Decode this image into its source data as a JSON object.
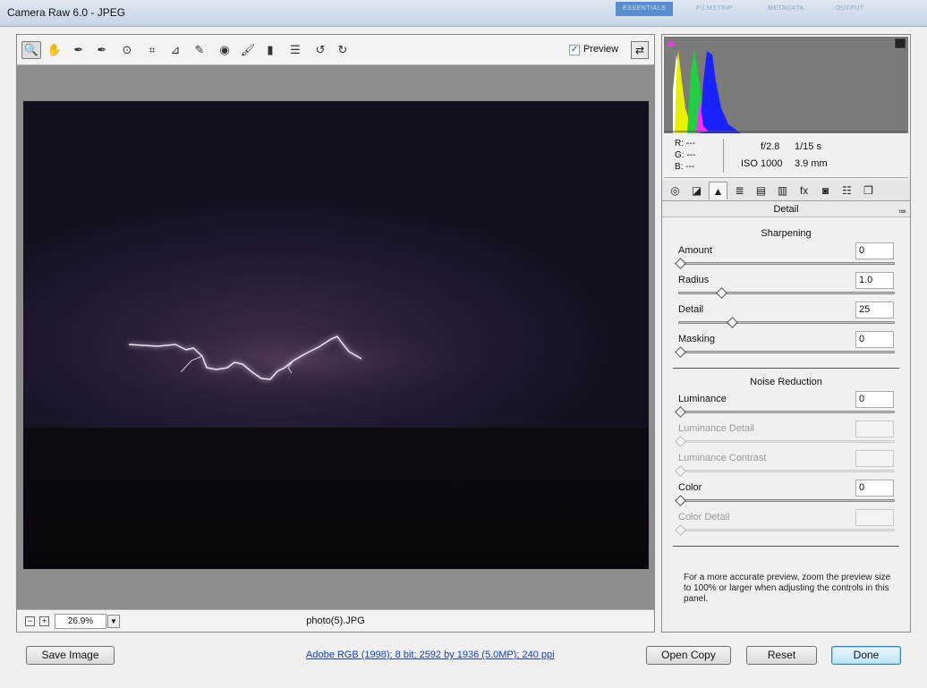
{
  "window": {
    "title": "Camera Raw 6.0  -  JPEG"
  },
  "workspace_tabs": [
    "ESSENTIALS",
    "FILMSTRIP",
    "METADATA",
    "OUTPUT"
  ],
  "toolbar": {
    "tools": [
      {
        "name": "zoom-tool",
        "glyph": "🔍"
      },
      {
        "name": "hand-tool",
        "glyph": "✋"
      },
      {
        "name": "white-balance-tool",
        "glyph": "✒"
      },
      {
        "name": "color-sampler-tool",
        "glyph": "✒"
      },
      {
        "name": "targeted-adjustment-tool",
        "glyph": "⊙"
      },
      {
        "name": "crop-tool",
        "glyph": "⌗"
      },
      {
        "name": "straighten-tool",
        "glyph": "⊿"
      },
      {
        "name": "spot-removal-tool",
        "glyph": "✎"
      },
      {
        "name": "red-eye-removal-tool",
        "glyph": "◉"
      },
      {
        "name": "adjustment-brush-tool",
        "glyph": "🖌"
      },
      {
        "name": "graduated-filter-tool",
        "glyph": "▮"
      },
      {
        "name": "preferences-tool",
        "glyph": "☰"
      },
      {
        "name": "rotate-ccw-tool",
        "glyph": "↺"
      },
      {
        "name": "rotate-cw-tool",
        "glyph": "↻"
      }
    ],
    "preview_label": "Preview",
    "preview_checked": "✓",
    "fullscreen_glyph": "⇄"
  },
  "statusbar": {
    "zoom_out": "−",
    "zoom_in": "+",
    "zoom_value": "26.9%",
    "zoom_dropdown": "▼",
    "filename": "photo(5).JPG"
  },
  "readout": {
    "r": "R:   ---",
    "g": "G:   ---",
    "b": "B:   ---",
    "aperture": "f/2.8",
    "shutter": "1/15 s",
    "iso": "ISO 1000",
    "focal": "3.9 mm"
  },
  "panel_tabs": [
    {
      "name": "basic-tab",
      "glyph": "◎"
    },
    {
      "name": "tone-curve-tab",
      "glyph": "◪"
    },
    {
      "name": "detail-tab",
      "glyph": "▲"
    },
    {
      "name": "hsl-tab",
      "glyph": "≣"
    },
    {
      "name": "split-toning-tab",
      "glyph": "▤"
    },
    {
      "name": "lens-corrections-tab",
      "glyph": "▥"
    },
    {
      "name": "effects-tab",
      "glyph": "fx"
    },
    {
      "name": "camera-calibration-tab",
      "glyph": "◙"
    },
    {
      "name": "presets-tab",
      "glyph": "☷"
    },
    {
      "name": "snapshots-tab",
      "glyph": "❐"
    }
  ],
  "panel": {
    "title": "Detail",
    "menu_glyph": "≔",
    "sharpening": {
      "title": "Sharpening",
      "amount": {
        "label": "Amount",
        "value": "0",
        "level": 0
      },
      "radius": {
        "label": "Radius",
        "value": "1.0",
        "level": 0.2
      },
      "detail": {
        "label": "Detail",
        "value": "25",
        "level": 0.25
      },
      "masking": {
        "label": "Masking",
        "value": "0",
        "level": 0
      }
    },
    "noise_reduction": {
      "title": "Noise Reduction",
      "luminance": {
        "label": "Luminance",
        "value": "0",
        "level": 0
      },
      "luminance_detail": {
        "label": "Luminance Detail",
        "value": "",
        "level": 0
      },
      "luminance_contrast": {
        "label": "Luminance Contrast",
        "value": "",
        "level": 0
      },
      "color": {
        "label": "Color",
        "value": "0",
        "level": 0
      },
      "color_detail": {
        "label": "Color Detail",
        "value": "",
        "level": 0
      }
    },
    "note": "For a more accurate preview, zoom the preview size to 100% or larger when adjusting the controls in this panel."
  },
  "footer": {
    "save_image": "Save Image",
    "workflow_info": "Adobe RGB (1998); 8 bit; 2592 by 1936 (5.0MP); 240 ppi",
    "open_copy": "Open Copy",
    "reset": "Reset",
    "done": "Done"
  }
}
